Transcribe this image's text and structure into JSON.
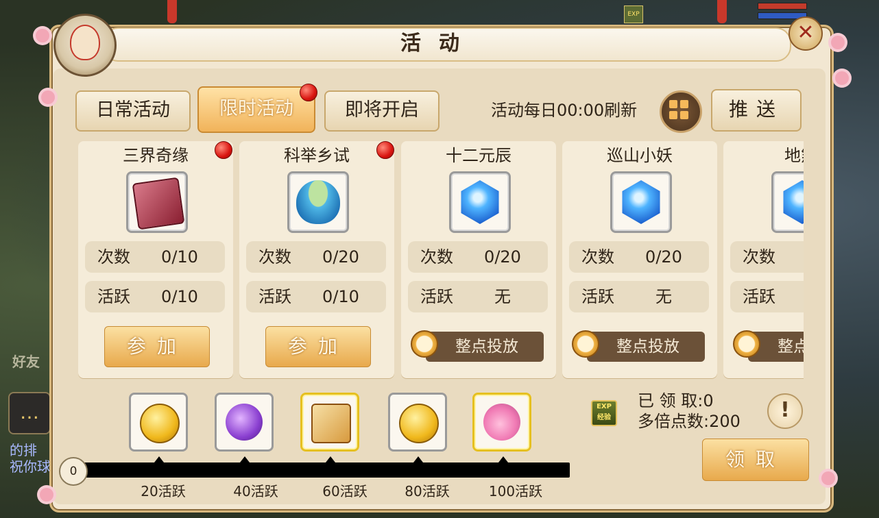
{
  "window": {
    "title": "活动"
  },
  "tabs": [
    {
      "label": "日常活动",
      "active": false,
      "badge": false
    },
    {
      "label": "限时活动",
      "active": true,
      "badge": true
    },
    {
      "label": "即将开启",
      "active": false,
      "badge": false
    }
  ],
  "header": {
    "refresh_notice": "活动每日00:00刷新",
    "push_label": "推送"
  },
  "activities": [
    {
      "name": "三界奇缘",
      "icon": "red-book-icon",
      "badge": true,
      "count_label": "次数",
      "count": "0/10",
      "active_label": "活跃",
      "active_value": "0/10",
      "action": "参加",
      "action_type": "join"
    },
    {
      "name": "科举乡试",
      "icon": "soup-bowl-icon",
      "badge": true,
      "count_label": "次数",
      "count": "0/20",
      "active_label": "活跃",
      "active_value": "0/10",
      "action": "参加",
      "action_type": "join"
    },
    {
      "name": "十二元辰",
      "icon": "blue-gem-icon",
      "badge": false,
      "count_label": "次数",
      "count": "0/20",
      "active_label": "活跃",
      "active_value": "无",
      "action": "整点投放",
      "action_type": "timed"
    },
    {
      "name": "巡山小妖",
      "icon": "blue-gem-icon",
      "badge": false,
      "count_label": "次数",
      "count": "0/20",
      "active_label": "活跃",
      "active_value": "无",
      "action": "整点投放",
      "action_type": "timed"
    },
    {
      "name": "地煞",
      "icon": "blue-gem-icon",
      "badge": false,
      "count_label": "次数",
      "count": "",
      "active_label": "活跃",
      "active_value": "",
      "action": "整点投放",
      "action_type": "timed"
    }
  ],
  "rewards": {
    "start": "0",
    "milestones": [
      {
        "label": "20活跃",
        "icon": "gold-coin-icon",
        "highlight": false
      },
      {
        "label": "40活跃",
        "icon": "purple-pouch-icon",
        "highlight": false
      },
      {
        "label": "60活跃",
        "icon": "treasure-scroll-icon",
        "highlight": true
      },
      {
        "label": "80活跃",
        "icon": "gold-coin-icon",
        "highlight": false
      },
      {
        "label": "100活跃",
        "icon": "lucky-bag-icon",
        "highlight": true
      }
    ],
    "progress": 0,
    "claimed_label": "已 领 取:0",
    "multiplier_label": "多倍点数:200",
    "exp_badge": "EXP 经验",
    "claim_label": "领取"
  },
  "side": {
    "friends_label": "好友",
    "chat_icon": "chat-bubble-icon",
    "chat_text": "的排 祝你球"
  },
  "colors": {
    "accent_gold": "#e8a94c",
    "panel_bg": "#f2e7d2",
    "badge_red": "#d9140f",
    "timed_button": "#6b5138"
  }
}
